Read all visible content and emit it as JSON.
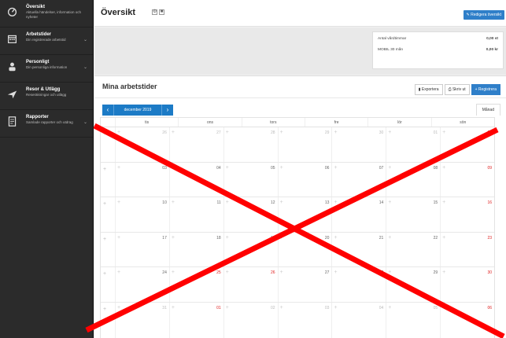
{
  "sidebar": {
    "items": [
      {
        "title": "Översikt",
        "sub": "Aktuella händelser, information och nyheter",
        "icon": "dashboard-icon",
        "chevron": false
      },
      {
        "title": "Arbetstider",
        "sub": "Din registrerade arbetstid",
        "icon": "calendar-icon",
        "chevron": true
      },
      {
        "title": "Personligt",
        "sub": "Din personliga information",
        "icon": "person-icon",
        "chevron": true
      },
      {
        "title": "Resor & Utlägg",
        "sub": "Reseräkningar och utlägg",
        "icon": "plane-icon",
        "chevron": false
      },
      {
        "title": "Rapporter",
        "sub": "Samlade rapporter och utdrag",
        "icon": "report-icon",
        "chevron": true
      }
    ]
  },
  "header": {
    "title": "Översikt",
    "edit_label": "Redigera översikt"
  },
  "summary": {
    "rows": [
      {
        "label": "Antal vårdtimmar",
        "value": "0,00 st"
      },
      {
        "label": "MOBIL 30 mån",
        "value": "0,00 kr"
      }
    ]
  },
  "work": {
    "title": "Mina arbetstider",
    "buttons": {
      "export": "Exportera",
      "print": "Skriv ut",
      "register": "+ Registrera"
    },
    "month": "december 2019",
    "view": "Månad",
    "weekdays": [
      "",
      "tis",
      "ons",
      "tors",
      "fre",
      "lör",
      "sön"
    ],
    "weeks": [
      [
        {
          "d": "26",
          "c": "muted"
        },
        {
          "d": "27",
          "c": "muted"
        },
        {
          "d": "28",
          "c": "muted"
        },
        {
          "d": "29",
          "c": "muted"
        },
        {
          "d": "30",
          "c": "muted"
        },
        {
          "d": "01",
          "c": "muted"
        },
        {
          "d": "02",
          "c": "red"
        }
      ],
      [
        {
          "d": "03",
          "c": ""
        },
        {
          "d": "04",
          "c": ""
        },
        {
          "d": "05",
          "c": ""
        },
        {
          "d": "06",
          "c": ""
        },
        {
          "d": "07",
          "c": ""
        },
        {
          "d": "08",
          "c": ""
        },
        {
          "d": "09",
          "c": "red"
        }
      ],
      [
        {
          "d": "10",
          "c": ""
        },
        {
          "d": "11",
          "c": ""
        },
        {
          "d": "12",
          "c": ""
        },
        {
          "d": "13",
          "c": ""
        },
        {
          "d": "14",
          "c": ""
        },
        {
          "d": "15",
          "c": ""
        },
        {
          "d": "16",
          "c": "red"
        }
      ],
      [
        {
          "d": "17",
          "c": ""
        },
        {
          "d": "18",
          "c": ""
        },
        {
          "d": "19",
          "c": ""
        },
        {
          "d": "20",
          "c": ""
        },
        {
          "d": "21",
          "c": ""
        },
        {
          "d": "22",
          "c": ""
        },
        {
          "d": "23",
          "c": "red"
        }
      ],
      [
        {
          "d": "24",
          "c": ""
        },
        {
          "d": "25",
          "c": "red"
        },
        {
          "d": "26",
          "c": "red"
        },
        {
          "d": "27",
          "c": ""
        },
        {
          "d": "28",
          "c": ""
        },
        {
          "d": "29",
          "c": ""
        },
        {
          "d": "30",
          "c": "red"
        }
      ],
      [
        {
          "d": "31",
          "c": "muted"
        },
        {
          "d": "01",
          "c": "red"
        },
        {
          "d": "02",
          "c": "muted"
        },
        {
          "d": "03",
          "c": "muted"
        },
        {
          "d": "04",
          "c": "muted"
        },
        {
          "d": "05",
          "c": "muted"
        },
        {
          "d": "06",
          "c": "red"
        }
      ]
    ]
  },
  "colors": {
    "accent": "#2f7fc9",
    "sidebar": "#2b2b2b",
    "holiday": "#e02020",
    "cross": "#ff0000"
  }
}
